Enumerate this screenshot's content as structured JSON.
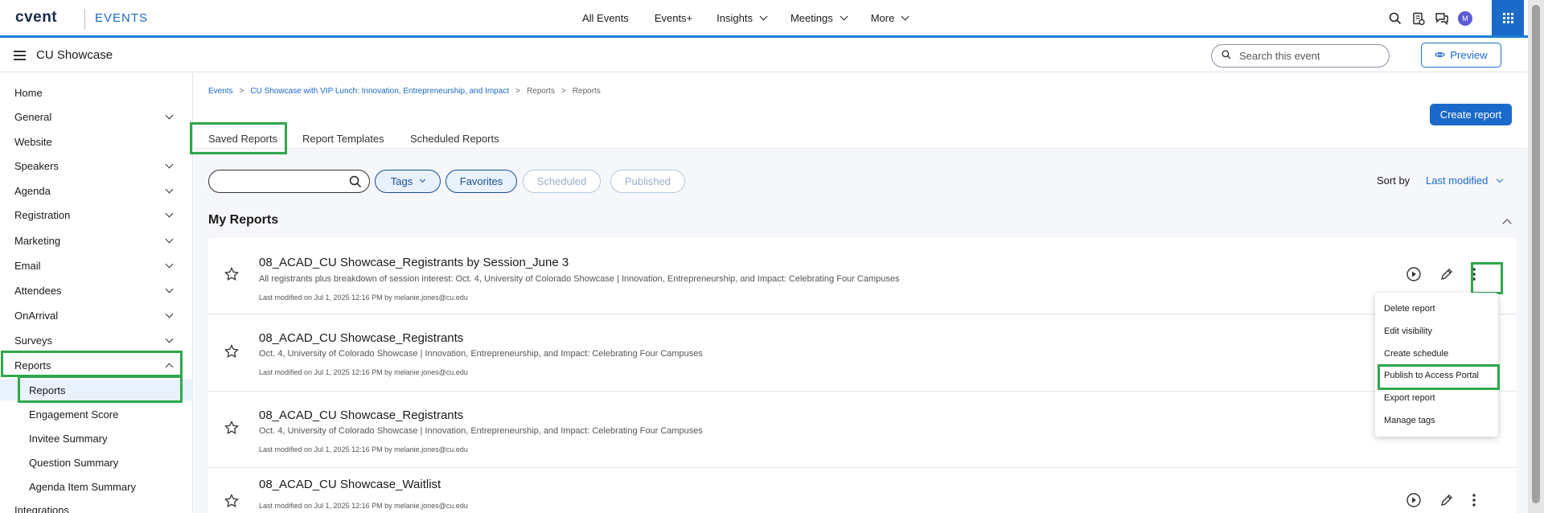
{
  "topbar": {
    "logo": "cvent",
    "product": "EVENTS",
    "nav": [
      {
        "label": "All Events",
        "dropdown": false
      },
      {
        "label": "Events+",
        "dropdown": false
      },
      {
        "label": "Insights",
        "dropdown": true
      },
      {
        "label": "Meetings",
        "dropdown": true
      },
      {
        "label": "More",
        "dropdown": true
      }
    ],
    "avatar_initials": "M",
    "accent_color": "#1b6ac9"
  },
  "event_header": {
    "title": "CU Showcase",
    "search_placeholder": "Search this event",
    "preview_label": "Preview"
  },
  "sidebar": {
    "items": [
      {
        "label": "Home",
        "expandable": false
      },
      {
        "label": "General",
        "expandable": true
      },
      {
        "label": "Website",
        "expandable": false
      },
      {
        "label": "Speakers",
        "expandable": true
      },
      {
        "label": "Agenda",
        "expandable": true
      },
      {
        "label": "Registration",
        "expandable": true
      },
      {
        "label": "Marketing",
        "expandable": true
      },
      {
        "label": "Email",
        "expandable": true
      },
      {
        "label": "Attendees",
        "expandable": true
      },
      {
        "label": "OnArrival",
        "expandable": true
      },
      {
        "label": "Surveys",
        "expandable": true
      },
      {
        "label": "Reports",
        "expandable": true,
        "expanded": true
      }
    ],
    "sub_items": [
      "Reports",
      "Engagement Score",
      "Invitee Summary",
      "Question Summary",
      "Agenda Item Summary"
    ],
    "trailing": "Integrations"
  },
  "breadcrumb": {
    "items": [
      "Events",
      "CU Showcase with VIP Lunch: Innovation, Entrepreneurship, and Impact",
      "Reports",
      "Reports"
    ],
    "separator": ">"
  },
  "create_report_label": "Create report",
  "tabs": [
    "Saved Reports",
    "Report Templates",
    "Scheduled Reports"
  ],
  "filters": {
    "search_value": "",
    "chips": [
      {
        "label": "Tags",
        "state": "on",
        "dropdown": true
      },
      {
        "label": "Favorites",
        "state": "on"
      },
      {
        "label": "Scheduled",
        "state": "off"
      },
      {
        "label": "Published",
        "state": "off"
      }
    ],
    "sort_label": "Sort by",
    "sort_value": "Last modified"
  },
  "section_title": "My Reports",
  "reports": [
    {
      "title": "08_ACAD_CU Showcase_Registrants by Session_June 3",
      "description": "All registrants plus breakdown of session interest: Oct. 4, University of Colorado Showcase | Innovation, Entrepreneurship, and Impact: Celebrating Four Campuses",
      "meta": "Last modified on Jul 1, 2025 12:16 PM by melanie.jones@cu.edu"
    },
    {
      "title": "08_ACAD_CU Showcase_Registrants",
      "description": "Oct. 4, University of Colorado Showcase | Innovation, Entrepreneurship, and Impact: Celebrating Four Campuses",
      "meta": "Last modified on Jul 1, 2025 12:16 PM by melanie.jones@cu.edu"
    },
    {
      "title": "08_ACAD_CU Showcase_Registrants",
      "description": "Oct. 4, University of Colorado Showcase | Innovation, Entrepreneurship, and Impact: Celebrating Four Campuses",
      "meta": "Last modified on Jul 1, 2025 12:16 PM by melanie.jones@cu.edu"
    },
    {
      "title": "08_ACAD_CU Showcase_Waitlist",
      "description": "",
      "meta": "Last modified on Jul 1, 2025 12:16 PM by melanie.jones@cu.edu"
    }
  ],
  "context_menu": [
    "Delete report",
    "Edit visibility",
    "Create schedule",
    "Publish to Access Portal",
    "Export report",
    "Manage tags"
  ],
  "highlight_color": "#2ea84a"
}
